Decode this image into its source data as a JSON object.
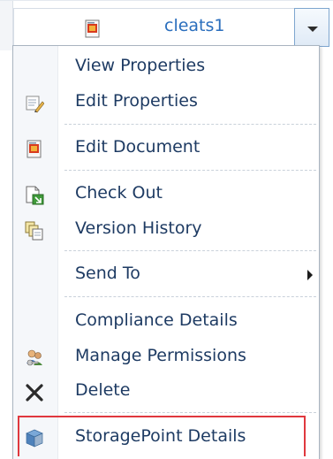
{
  "list_item": {
    "title": "cleats1",
    "doc_icon": "document-icon",
    "dropdown_icon": "chevron-down-icon"
  },
  "menu": {
    "items": [
      {
        "label": "View Properties",
        "icon": ""
      },
      {
        "label": "Edit Properties",
        "icon": "edit-properties-icon"
      },
      {
        "label": "Edit Document",
        "icon": "edit-document-icon"
      },
      {
        "label": "Check Out",
        "icon": "check-out-icon"
      },
      {
        "label": "Version History",
        "icon": "version-history-icon"
      },
      {
        "label": "Send To",
        "icon": "",
        "submenu_icon": "chevron-right-icon"
      },
      {
        "label": "Compliance Details",
        "icon": ""
      },
      {
        "label": "Manage Permissions",
        "icon": "manage-permissions-icon"
      },
      {
        "label": "Delete",
        "icon": "delete-icon"
      },
      {
        "label": "StoragePoint Details",
        "icon": "storagepoint-icon"
      }
    ]
  },
  "colors": {
    "title_text": "#2a6ebd",
    "menu_text": "#1e3b63",
    "highlight_border": "#e0383e"
  }
}
